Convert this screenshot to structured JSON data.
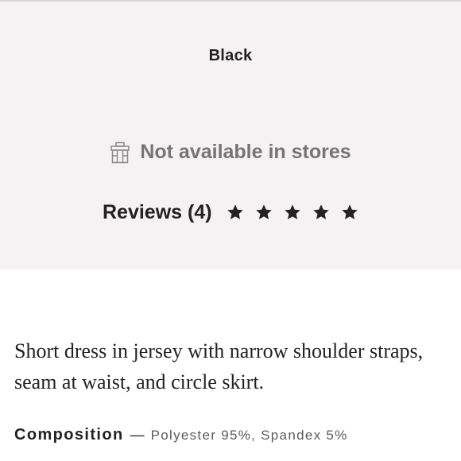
{
  "product": {
    "color_name": "Black"
  },
  "availability": {
    "icon": "store-icon",
    "text": "Not available in stores"
  },
  "reviews": {
    "label": "Reviews (4)",
    "rating": 5,
    "max_rating": 5,
    "star_icon": "star-icon"
  },
  "description": {
    "text": "Short dress in jersey with narrow shoulder straps, seam at waist, and circle skirt."
  },
  "composition": {
    "label": "Composition",
    "separator": "—",
    "value": "Polyester 95%, Spandex 5%"
  },
  "colors": {
    "panel_background": "#f4f2f2",
    "text_primary": "#222222",
    "text_muted": "#757575",
    "divider": "#d7d3d1"
  }
}
